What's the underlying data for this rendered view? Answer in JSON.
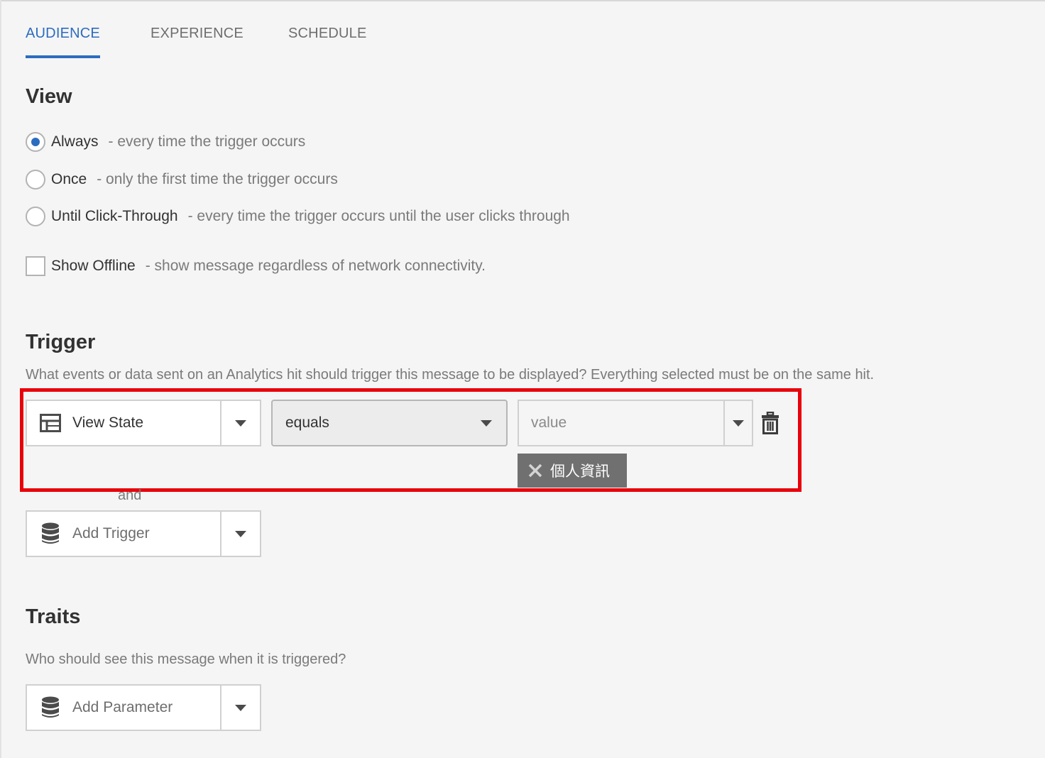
{
  "tabs": [
    {
      "label": "AUDIENCE",
      "active": true
    },
    {
      "label": "EXPERIENCE",
      "active": false
    },
    {
      "label": "SCHEDULE",
      "active": false
    }
  ],
  "view": {
    "title": "View",
    "options": [
      {
        "label": "Always",
        "desc": "- every time the trigger occurs",
        "checked": true
      },
      {
        "label": "Once",
        "desc": "- only the first time the trigger occurs",
        "checked": false
      },
      {
        "label": "Until Click-Through",
        "desc": "- every time the trigger occurs until the user clicks through",
        "checked": false
      }
    ],
    "offline": {
      "label": "Show Offline",
      "desc": "- show message regardless of network connectivity.",
      "checked": false
    }
  },
  "trigger": {
    "title": "Trigger",
    "desc": "What events or data sent on an Analytics hit should trigger this message to be displayed? Everything selected must be on the same hit.",
    "field": "View State",
    "operator": "equals",
    "value_placeholder": "value",
    "tag": "個人資訊",
    "and_label": "and",
    "add_trigger": "Add Trigger"
  },
  "traits": {
    "title": "Traits",
    "desc": "Who should see this message when it is triggered?",
    "add_parameter": "Add Parameter"
  },
  "colors": {
    "accent": "#2c6cbf",
    "highlight": "#e8000b",
    "tag_bg": "#707070"
  },
  "icons": {
    "field": "table-icon",
    "add": "database-icon",
    "delete": "trash-icon",
    "remove_tag": "close-icon",
    "dropdown": "chevron-down-icon"
  }
}
